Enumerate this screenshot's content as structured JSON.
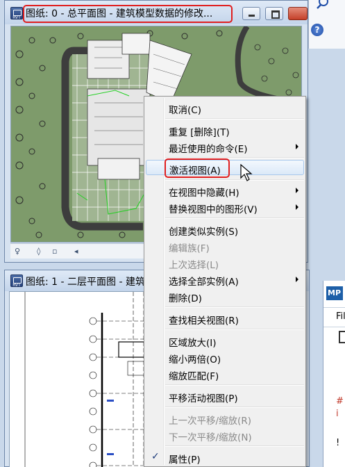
{
  "top_window": {
    "title": "图纸: 0 - 总平面图 - 建筑模型数据的修改...",
    "icon_label": "RVT"
  },
  "bottom_window": {
    "title": "图纸: 1 - 二层平面图 - 建筑"
  },
  "context_menu": {
    "items": [
      {
        "label": "取消(C)"
      },
      {
        "label": "重复 [删除](T)"
      },
      {
        "label": "最近使用的命令(E)"
      },
      {
        "label": "激活视图(A)"
      },
      {
        "label": "在视图中隐藏(H)"
      },
      {
        "label": "替换视图中的图形(V)"
      },
      {
        "label": "创建类似实例(S)"
      },
      {
        "label": "编辑族(F)"
      },
      {
        "label": "上次选择(L)"
      },
      {
        "label": "选择全部实例(A)"
      },
      {
        "label": "删除(D)"
      },
      {
        "label": "查找相关视图(R)"
      },
      {
        "label": "区域放大(I)"
      },
      {
        "label": "缩小两倍(O)"
      },
      {
        "label": "缩放匹配(F)"
      },
      {
        "label": "平移活动视图(P)"
      },
      {
        "label": "上一次平移/缩放(R)"
      },
      {
        "label": "下一次平移/缩放(N)"
      },
      {
        "label": "属性(P)"
      }
    ],
    "checked_mark": "✓"
  },
  "right_panel": {
    "logo": "MP",
    "menu_text": "Fil",
    "line1": "#",
    "line2": "i",
    "line3": "!"
  },
  "accent_color": "#e01e1e"
}
